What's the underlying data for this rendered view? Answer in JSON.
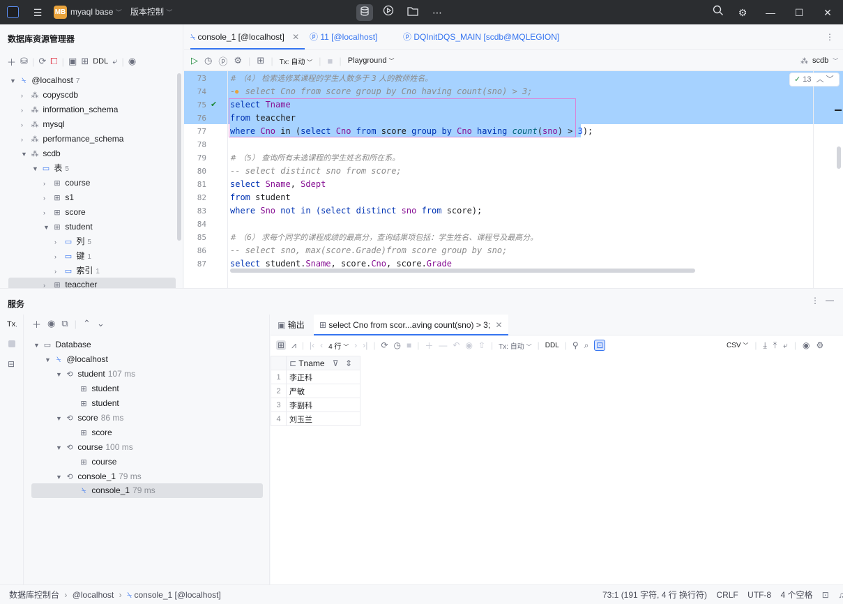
{
  "titlebar": {
    "project_badge": "MB",
    "project_name": "myaql base",
    "vcs": "版本控制"
  },
  "left_pane": {
    "title": "数据库资源管理器",
    "ddl_label": "DDL",
    "tree": [
      {
        "label": "@localhost",
        "count": "7"
      },
      {
        "label": "copyscdb"
      },
      {
        "label": "information_schema"
      },
      {
        "label": "mysql"
      },
      {
        "label": "performance_schema"
      },
      {
        "label": "scdb"
      },
      {
        "label": "表",
        "count": "5"
      },
      {
        "label": "course"
      },
      {
        "label": "s1"
      },
      {
        "label": "score"
      },
      {
        "label": "student"
      },
      {
        "label": "列",
        "count": "5"
      },
      {
        "label": "键",
        "count": "1"
      },
      {
        "label": "索引",
        "count": "1"
      },
      {
        "label": "teaccher"
      }
    ]
  },
  "editor": {
    "tabs": [
      {
        "label": "console_1 [@localhost]"
      },
      {
        "label": "11 [@localhost]"
      },
      {
        "label": "DQInitDQS_MAIN [scdb@MQLEGION]"
      }
    ],
    "tx_label": "Tx: 自动",
    "playground_label": "Playground",
    "schema_label": "scdb",
    "inspection_count": "13",
    "line_numbers": [
      "73",
      "74",
      "75",
      "76",
      "77",
      "78",
      "79",
      "80",
      "81",
      "82",
      "83",
      "84",
      "85",
      "86",
      "87"
    ],
    "lines": [
      {
        "text": "# （4） 检索选修某课程的学生人数多于 3 人的教师姓名。"
      },
      {
        "text": "-- select Cno from score group by Cno having count(sno) > 3;"
      },
      {
        "a": "select",
        "b": " Tname"
      },
      {
        "a": "from",
        "b": " teaccher"
      },
      {
        "w1": "where",
        "w2": " Cno",
        "w3": " in (",
        "w4": "select",
        "w5": " Cno ",
        "w6": "from",
        "w7": " score ",
        "w8": "group by",
        "w9": " Cno ",
        "w10": "having",
        "w11": " count",
        "w12": "(",
        "w13": "sno",
        "w14": ") > ",
        "w15": "3",
        "w16": ");"
      },
      {
        "text": ""
      },
      {
        "text": "# （5） 查询所有未选课程的学生姓名和所在系。"
      },
      {
        "text": "-- select distinct sno from score;"
      },
      {
        "a": "select",
        "b": " Sname",
        "c": ", ",
        "d": "Sdept"
      },
      {
        "a": "from",
        "b": " student"
      },
      {
        "w1": "where",
        "w2": " Sno",
        "w3": " not in (",
        "w4": "select distinct",
        "w5": " sno ",
        "w6": "from",
        "w7": " score);"
      },
      {
        "text": ""
      },
      {
        "text": "# （6） 求每个同学的课程成绩的最高分，查询结果项包括：学生姓名、课程号及最高分。"
      },
      {
        "text": "-- select sno, max(score.Grade)from score group by sno;"
      },
      {
        "a": "select",
        "b": " student.",
        "c": "Sname",
        "d": ", score.",
        "e": "Cno",
        "f": ", score.",
        "g": "Grade"
      }
    ]
  },
  "services": {
    "title": "服务",
    "tx_label": "Tx",
    "tree": [
      {
        "label": "Database"
      },
      {
        "label": "@localhost"
      },
      {
        "label": "student",
        "ms": "107 ms"
      },
      {
        "label": "student"
      },
      {
        "label": "student"
      },
      {
        "label": "score",
        "ms": "86 ms"
      },
      {
        "label": "score"
      },
      {
        "label": "course",
        "ms": "100 ms"
      },
      {
        "label": "course"
      },
      {
        "label": "console_1",
        "ms": "79 ms"
      },
      {
        "label": "console_1",
        "ms": "79 ms"
      }
    ],
    "result_tabs": [
      {
        "label": "输出"
      },
      {
        "label": "select Cno from scor...aving count(sno) > 3;"
      }
    ],
    "rows_label": "4 行",
    "tx_label2": "Tx: 自动",
    "ddl_label": "DDL",
    "csv_label": "CSV",
    "column": "Tname",
    "rows": [
      {
        "n": "1",
        "v": "李正科"
      },
      {
        "n": "2",
        "v": "严敏"
      },
      {
        "n": "3",
        "v": "李副科"
      },
      {
        "n": "4",
        "v": "刘玉兰"
      }
    ]
  },
  "statusbar": {
    "crumbs": [
      "数据库控制台",
      "@localhost",
      "console_1 [@localhost]"
    ],
    "position": "73:1 (191 字符, 4 行 换行符)",
    "line_sep": "CRLF",
    "encoding": "UTF-8",
    "indent": "4 个空格"
  },
  "colors": {
    "accent": "#3574f0",
    "selection": "#a6d2ff",
    "titlebar": "#2b2d30"
  }
}
